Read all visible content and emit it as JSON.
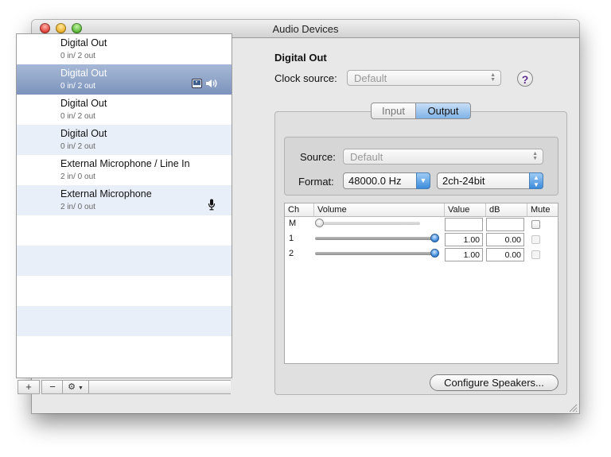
{
  "window": {
    "title": "Audio Devices"
  },
  "devices": [
    {
      "name": "Digital Out",
      "io": "0 in/ 2 out",
      "state": "normal",
      "icons": []
    },
    {
      "name": "Digital Out",
      "io": "0 in/ 2 out",
      "state": "selected",
      "icons": [
        "finder-alert-icon",
        "speaker-icon"
      ]
    },
    {
      "name": "Digital Out",
      "io": "0 in/ 2 out",
      "state": "normal",
      "icons": []
    },
    {
      "name": "Digital Out",
      "io": "0 in/ 2 out",
      "state": "alt",
      "icons": []
    },
    {
      "name": "External Microphone / Line In",
      "io": "2 in/ 0 out",
      "state": "normal",
      "icons": []
    },
    {
      "name": "External Microphone",
      "io": "2 in/ 0 out",
      "state": "alt",
      "icons": [
        "microphone-icon"
      ]
    }
  ],
  "list_buttons": {
    "add": "+",
    "remove": "−",
    "action": "⚙"
  },
  "detail": {
    "device_title": "Digital Out",
    "clock_source_label": "Clock source:",
    "clock_source_value": "Default",
    "help": "?",
    "tabs": {
      "input": "Input",
      "output": "Output",
      "active": "Output"
    },
    "source_label": "Source:",
    "source_value": "Default",
    "format_label": "Format:",
    "format_rate": "48000.0 Hz",
    "format_bits": "2ch-24bit",
    "columns": [
      "Ch",
      "Volume",
      "Value",
      "dB",
      "Mute"
    ],
    "channels": [
      {
        "ch": "M",
        "volume": 0,
        "value": "",
        "db": "",
        "mute_enabled": true
      },
      {
        "ch": "1",
        "volume": 1.0,
        "value": "1.00",
        "db": "0.00",
        "mute_enabled": false
      },
      {
        "ch": "2",
        "volume": 1.0,
        "value": "1.00",
        "db": "0.00",
        "mute_enabled": false
      }
    ],
    "configure_button": "Configure Speakers..."
  },
  "colors": {
    "selection": "#7d93bc",
    "accent": "#3a86d8",
    "alt_row": "#e9eff9"
  }
}
